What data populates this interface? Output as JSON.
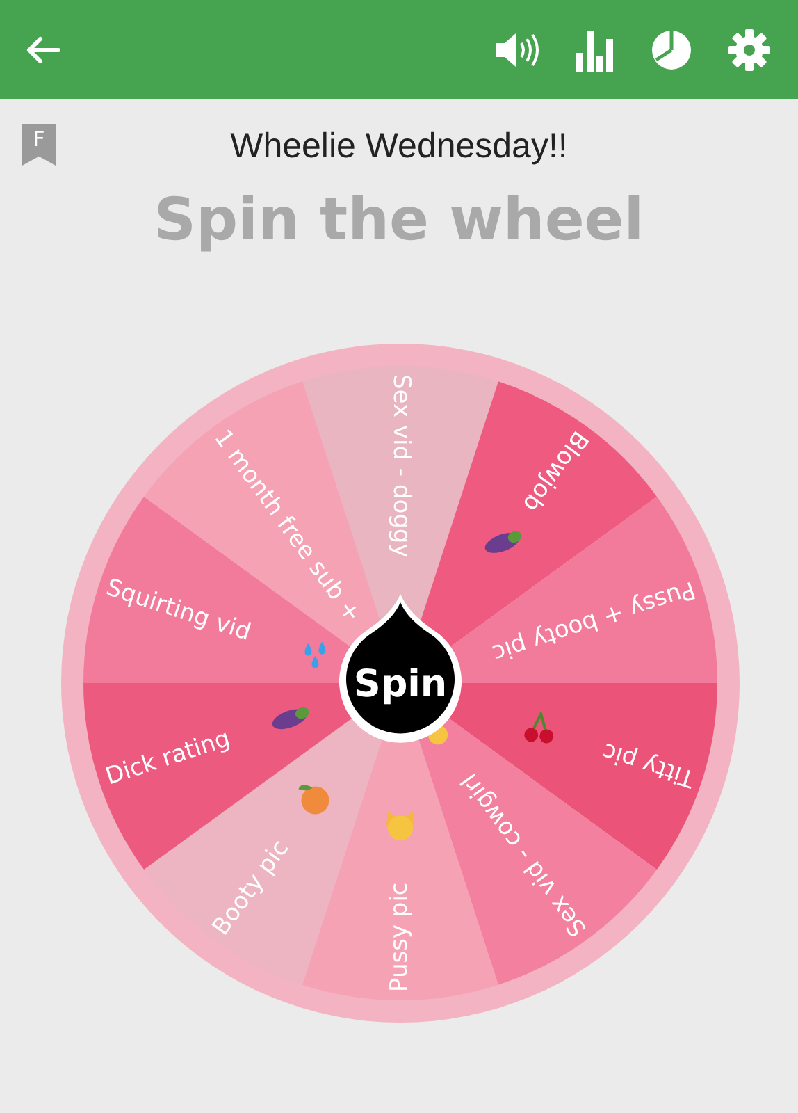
{
  "badge": "F",
  "title": "Wheelie Wednesday!!",
  "heading": "Spin the wheel",
  "wheel": {
    "segments": [
      {
        "label": "Sex vid - doggy",
        "color": "#e9b5c0"
      },
      {
        "label": "Blowjob",
        "color": "#ee5a80"
      },
      {
        "label": "Pussy + booty pic",
        "color": "#f27b9b"
      },
      {
        "label": "Titty pic",
        "color": "#ec5379"
      },
      {
        "label": "Sex vid - cowgirl",
        "color": "#f2809e"
      },
      {
        "label": "Pussy pic",
        "color": "#f4a2b4"
      },
      {
        "label": "Booty pic",
        "color": "#ecb5c1"
      },
      {
        "label": "Dick rating",
        "color": "#ec5a80"
      },
      {
        "label": "Squirting vid",
        "color": "#f27b9b"
      },
      {
        "label": "1 month free sub +",
        "color": "#f4a2b4"
      }
    ]
  },
  "spin_button": "Spin"
}
